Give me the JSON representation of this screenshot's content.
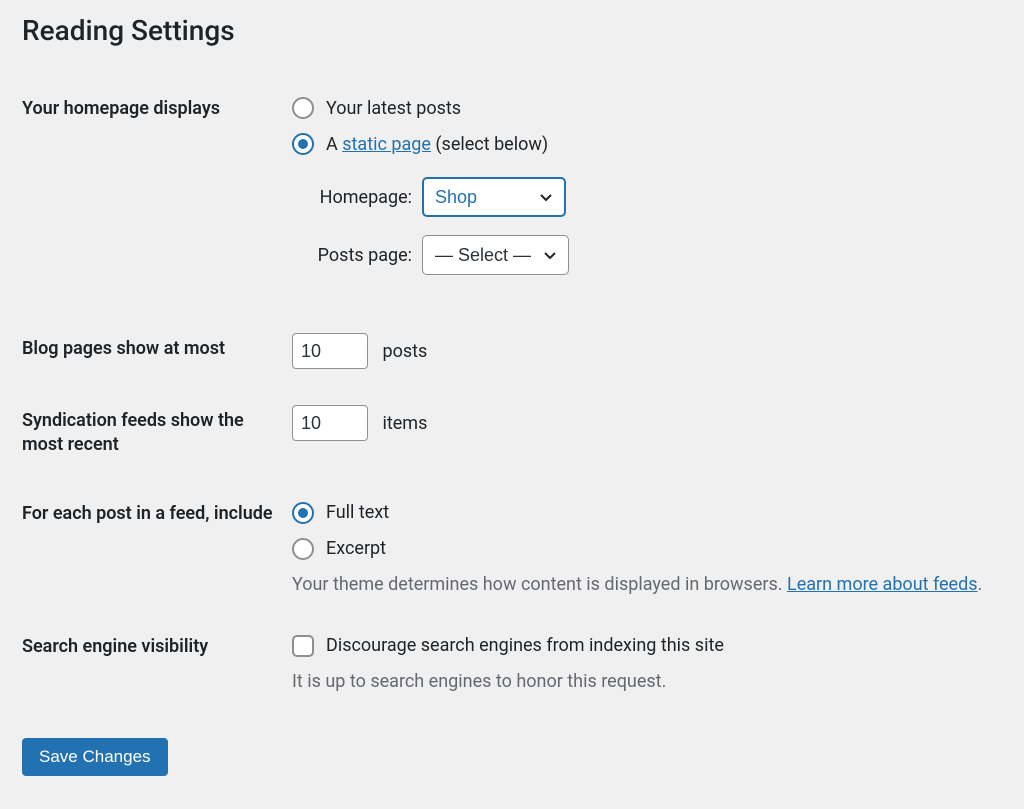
{
  "page": {
    "title": "Reading Settings"
  },
  "homepage": {
    "label": "Your homepage displays",
    "option_latest": "Your latest posts",
    "option_static_prefix": "A ",
    "option_static_link": "static page",
    "option_static_suffix": " (select below)",
    "selected": "static",
    "homepage_label": "Homepage:",
    "homepage_value": "Shop",
    "postspage_label": "Posts page:",
    "postspage_value": "— Select —"
  },
  "blog_pages": {
    "label": "Blog pages show at most",
    "value": "10",
    "unit": "posts"
  },
  "syndication": {
    "label": "Syndication feeds show the most recent",
    "value": "10",
    "unit": "items"
  },
  "feed_include": {
    "label": "For each post in a feed, include",
    "option_full": "Full text",
    "option_excerpt": "Excerpt",
    "selected": "full",
    "description_prefix": "Your theme determines how content is displayed in browsers. ",
    "description_link": "Learn more about feeds",
    "description_suffix": "."
  },
  "search_visibility": {
    "label": "Search engine visibility",
    "checkbox_label": "Discourage search engines from indexing this site",
    "description": "It is up to search engines to honor this request."
  },
  "submit": {
    "label": "Save Changes"
  }
}
